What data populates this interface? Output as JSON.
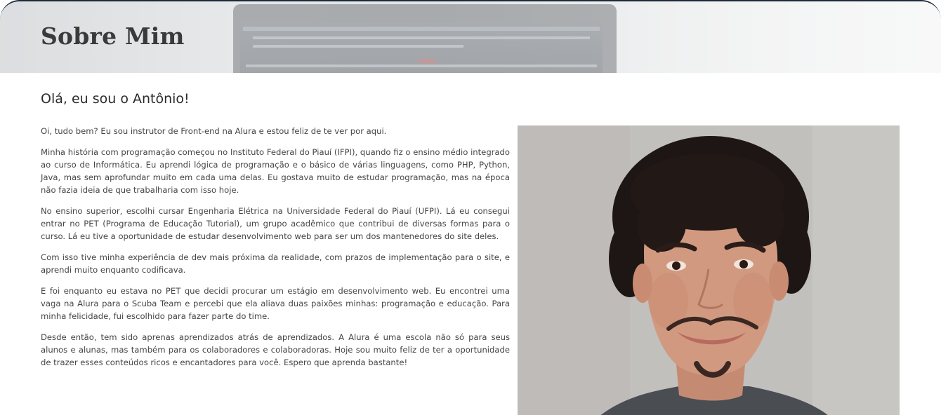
{
  "header": {
    "title": "Sobre Mim"
  },
  "main": {
    "heading": "Olá, eu sou o Antônio!",
    "paragraphs": [
      "Oi, tudo bem? Eu sou instrutor de Front-end na Alura e estou feliz de te ver por aqui.",
      "Minha história com programação começou no Instituto Federal do Piauí (IFPI), quando fiz o ensino médio integrado ao curso de Informática. Eu aprendi lógica de programação e o básico de várias linguagens, como PHP, Python, Java, mas sem aprofundar muito em cada uma delas. Eu gostava muito de estudar programação, mas na época não fazia ideia de que trabalharia com isso hoje.",
      "No ensino superior, escolhi cursar Engenharia Elétrica na Universidade Federal do Piauí (UFPI). Lá eu consegui entrar no PET (Programa de Educação Tutorial), um grupo acadêmico que contribui de diversas formas para o curso. Lá eu tive a oportunidade de estudar desenvolvimento web para ser um dos mantenedores do site deles.",
      "Com isso tive minha experiência de dev mais próxima da realidade, com prazos de implementação para o site, e aprendi muito enquanto codificava.",
      "E foi enquanto eu estava no PET que decidi procurar um estágio em desenvolvimento web. Eu encontrei uma vaga na Alura para o Scuba Team e percebi que ela aliava duas paixões minhas: programação e educação. Para minha felicidade, fui escolhido para fazer parte do time.",
      "Desde então, tem sido aprenas aprendizados atrás de aprendizados. A Alura é uma escola não só para seus alunos e alunas, mas também para os colaboradores e colaboradoras. Hoje sou muito feliz de ter a oportunidade de trazer esses conteúdos ricos e encantadores para você. Espero que aprenda bastante!"
    ]
  }
}
